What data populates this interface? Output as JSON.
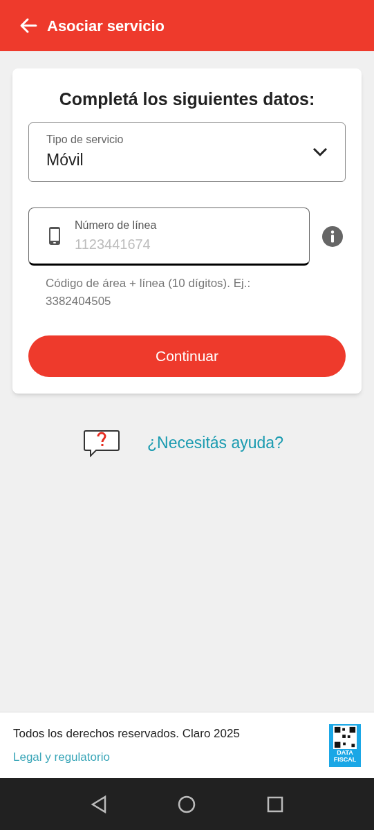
{
  "header": {
    "title": "Asociar servicio"
  },
  "form": {
    "heading": "Completá los siguientes datos:",
    "service_type": {
      "label": "Tipo de servicio",
      "value": "Móvil"
    },
    "line_number": {
      "label": "Número de línea",
      "placeholder": "1123441674",
      "hint": "Código de área + línea (10 dígitos). Ej.: 3382404505"
    },
    "submit": "Continuar"
  },
  "help": {
    "link": "¿Necesitás ayuda?"
  },
  "footer": {
    "copyright": "Todos los derechos reservados. Claro 2025",
    "link": "Legal y regulatorio",
    "logo_lines": [
      "DATA",
      "FISCAL"
    ]
  }
}
